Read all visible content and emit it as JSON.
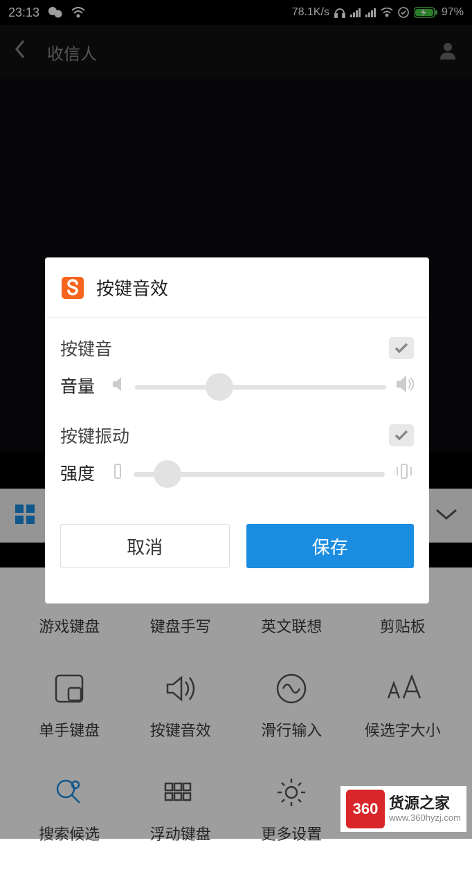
{
  "status": {
    "time": "23:13",
    "net_speed": "78.1K/s",
    "battery_pct": "97%"
  },
  "nav": {
    "title": "收信人"
  },
  "dialog": {
    "title": "按键音效",
    "sound_label": "按键音",
    "volume_label": "音量",
    "vibrate_label": "按键振动",
    "intensity_label": "强度",
    "cancel": "取消",
    "save": "保存",
    "volume_value": 28,
    "intensity_value": 8,
    "sound_checked": true,
    "vibrate_checked": true
  },
  "settings": {
    "items": [
      {
        "label": "游戏键盘"
      },
      {
        "label": "键盘手写"
      },
      {
        "label": "英文联想"
      },
      {
        "label": "剪贴板"
      },
      {
        "label": "单手键盘"
      },
      {
        "label": "按键音效"
      },
      {
        "label": "滑行输入"
      },
      {
        "label": "候选字大小"
      },
      {
        "label": "搜索候选"
      },
      {
        "label": "浮动键盘"
      },
      {
        "label": "更多设置"
      }
    ]
  },
  "watermark": {
    "badge": "360",
    "main": "货源之家",
    "sub": "www.360hyzj.com"
  }
}
